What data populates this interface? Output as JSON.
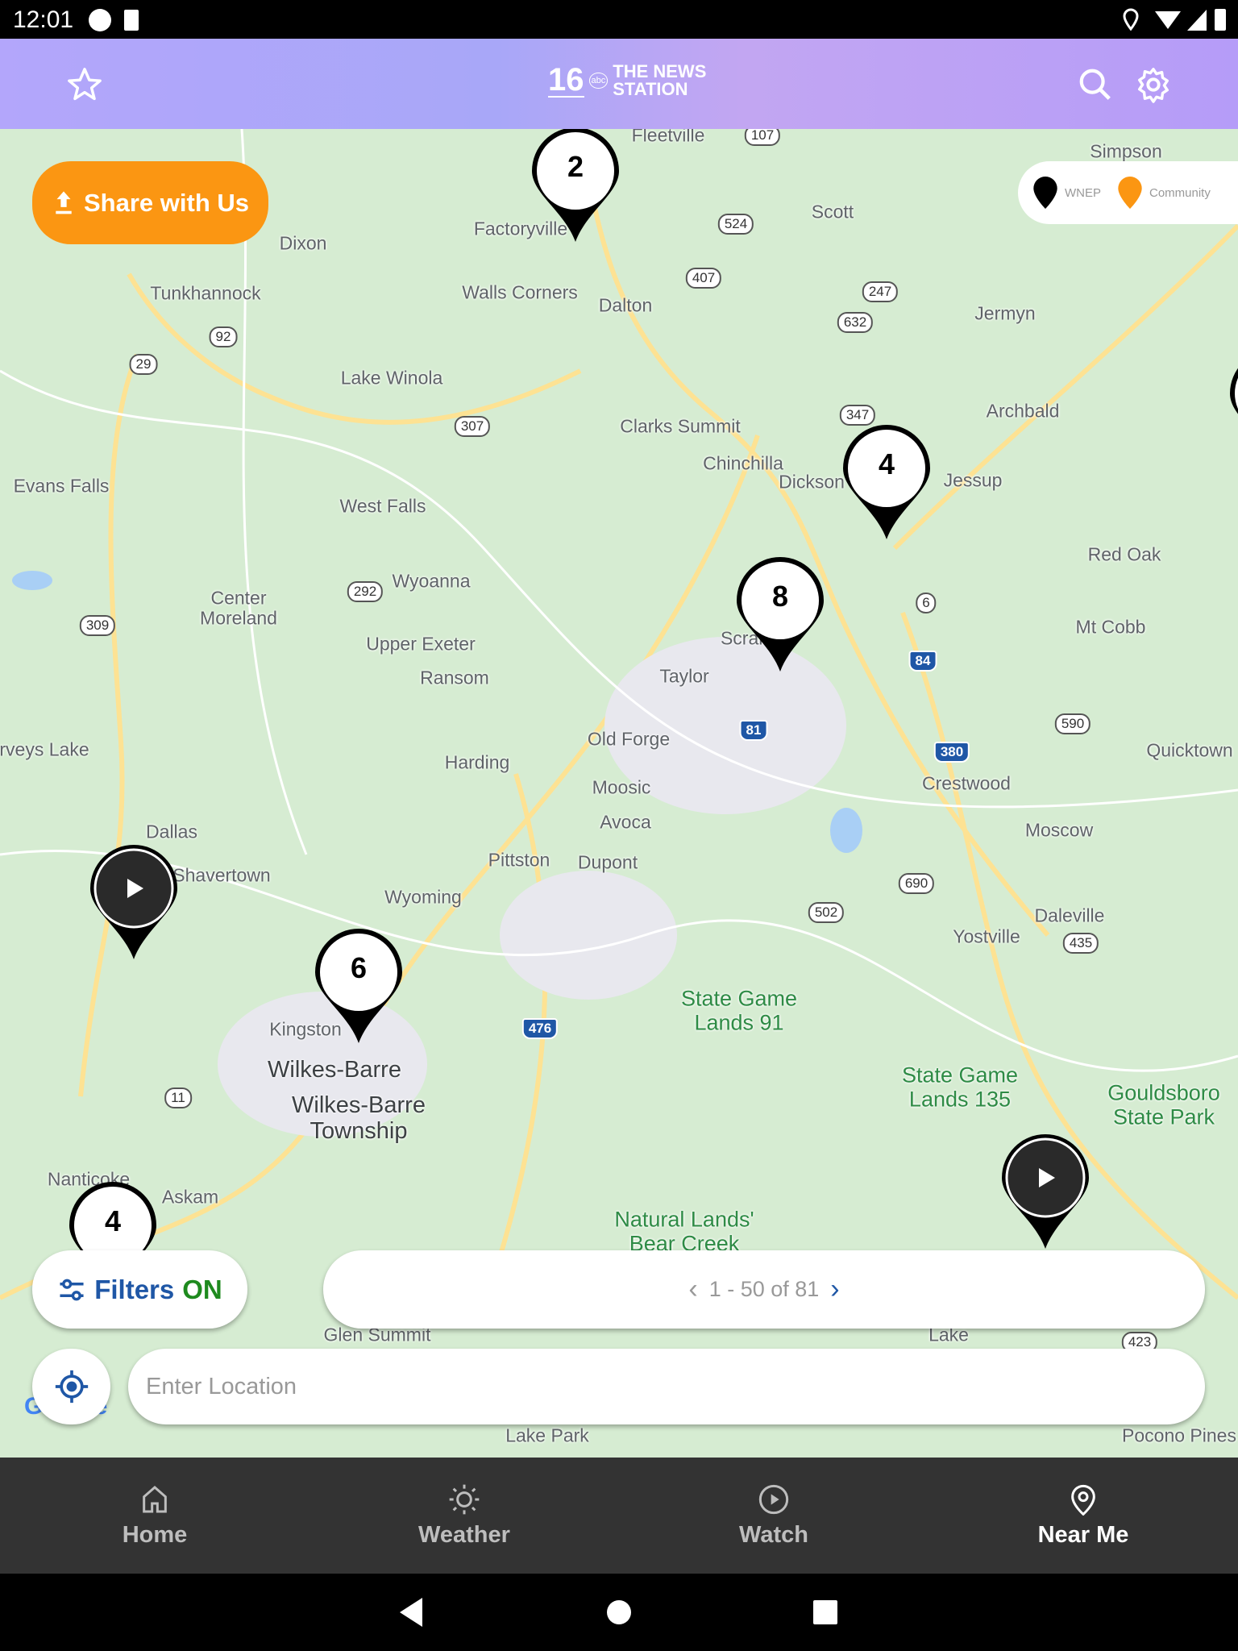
{
  "status_bar": {
    "time": "12:01"
  },
  "header": {
    "logo_text": "THE NEWS STATION",
    "logo_channel": "16",
    "logo_call": "WNEP",
    "logo_network": "abc"
  },
  "share_button": {
    "label": "Share with Us"
  },
  "legend": {
    "items": [
      {
        "label": "WNEP",
        "color": "#000000"
      },
      {
        "label": "Community",
        "color": "#fb9612"
      }
    ]
  },
  "markers": [
    {
      "count": "2"
    },
    {
      "count": "4"
    },
    {
      "count": "8"
    },
    {
      "count": "6"
    },
    {
      "count": "4"
    }
  ],
  "video_markers": 2,
  "map": {
    "labels": [
      "Fleetville",
      "Simpson",
      "Scott",
      "Factoryville",
      "Dixon",
      "Tunkhannock",
      "Walls Corners",
      "Dalton",
      "Jermyn",
      "Lake Winola",
      "Archbald",
      "Clarks Summit",
      "Chinchilla",
      "Jessup",
      "Evans Falls",
      "West Falls",
      "Red Oak",
      "Wyoanna",
      "Center\nMoreland",
      "Mt Cobb",
      "Upper Exeter",
      "Ransom",
      "Taylor",
      "Old Forge",
      "Harding",
      "Quicktown",
      "rveys Lake",
      "Moosic",
      "Crestwood",
      "Avoca",
      "Moscow",
      "Dallas",
      "Shavertown",
      "Pittston",
      "Dupont",
      "Wyoming",
      "Daleville",
      "Yostville",
      "Kingston",
      "Askam",
      "Nanticoke",
      "Glen Summit",
      "Lake",
      "Lake Park",
      "Pocono Pines",
      "Dickson City",
      "Scranton"
    ],
    "big_labels": [
      "Wilkes-Barre",
      "Wilkes-Barre\nTownship"
    ],
    "green_labels": [
      "State Game\nLands 91",
      "State Game\nLands 135",
      "Gouldsboro\nState Park",
      "Natural Lands'\nBear Creek"
    ],
    "shields": [
      "107",
      "524",
      "407",
      "247",
      "632",
      "92",
      "29",
      "307",
      "347",
      "292",
      "309",
      "6",
      "590",
      "690",
      "502",
      "435",
      "11",
      "423"
    ],
    "interstates": [
      "84",
      "81",
      "380",
      "476"
    ],
    "attribution": "Google"
  },
  "filters": {
    "label": "Filters",
    "state": "ON",
    "state_color": "#1e8a1e"
  },
  "pagination": {
    "text": "1 - 50 of 81"
  },
  "location_input": {
    "placeholder": "Enter Location",
    "value": ""
  },
  "bottom_nav": [
    {
      "label": "Home",
      "icon": "home-icon"
    },
    {
      "label": "Weather",
      "icon": "sun-icon"
    },
    {
      "label": "Watch",
      "icon": "play-circle-icon"
    },
    {
      "label": "Near Me",
      "icon": "location-pin-icon",
      "active": true
    }
  ],
  "colors": {
    "accent": "#1f57a6",
    "share": "#fb9612",
    "header": "#b3a6fb",
    "nav": "#333333"
  }
}
